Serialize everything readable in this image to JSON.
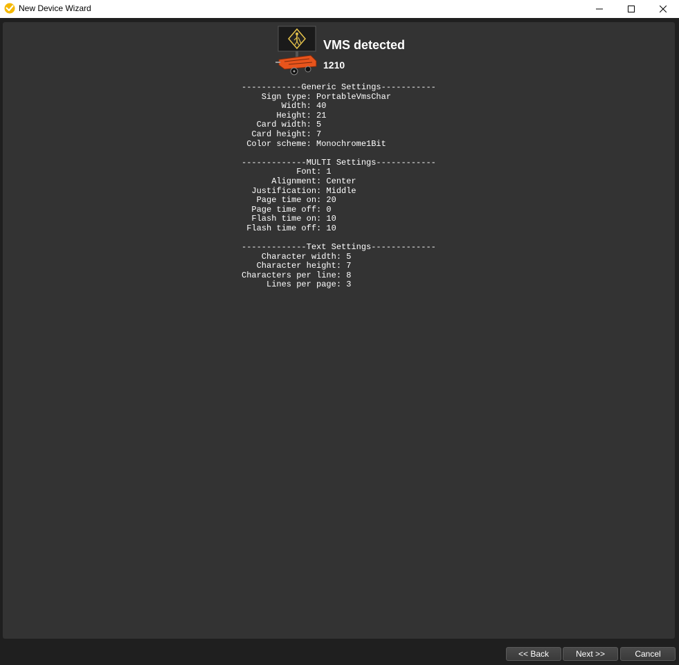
{
  "window": {
    "title": "New Device Wizard",
    "app_icon": "app-logo-icon",
    "controls": [
      "minimize-icon",
      "maximize-icon",
      "close-icon"
    ]
  },
  "header": {
    "image": "portable-vms-trailer-icon",
    "title": "VMS detected",
    "subtitle": "1210"
  },
  "report": {
    "lines": [
      "------------Generic Settings-----------",
      "    Sign type: PortableVmsChar",
      "        Width: 40",
      "       Height: 21",
      "   Card width: 5",
      "  Card height: 7",
      " Color scheme: Monochrome1Bit",
      "",
      "-------------MULTI Settings------------",
      "           Font: 1",
      "      Alignment: Center",
      "  Justification: Middle",
      "   Page time on: 20",
      "  Page time off: 0",
      "  Flash time on: 10",
      " Flash time off: 10",
      "",
      "-------------Text Settings-------------",
      "    Character width: 5",
      "   Character height: 7",
      "Characters per line: 8",
      "     Lines per page: 3"
    ]
  },
  "footer": {
    "back_label": "<< Back",
    "next_label": "Next >>",
    "cancel_label": "Cancel"
  },
  "colors": {
    "content_bg": "#333333",
    "window_bg": "#1f1f1f",
    "text": "#ffffff",
    "trailer_orange": "#e8541c",
    "sign_symbol": "#e6c34a"
  }
}
